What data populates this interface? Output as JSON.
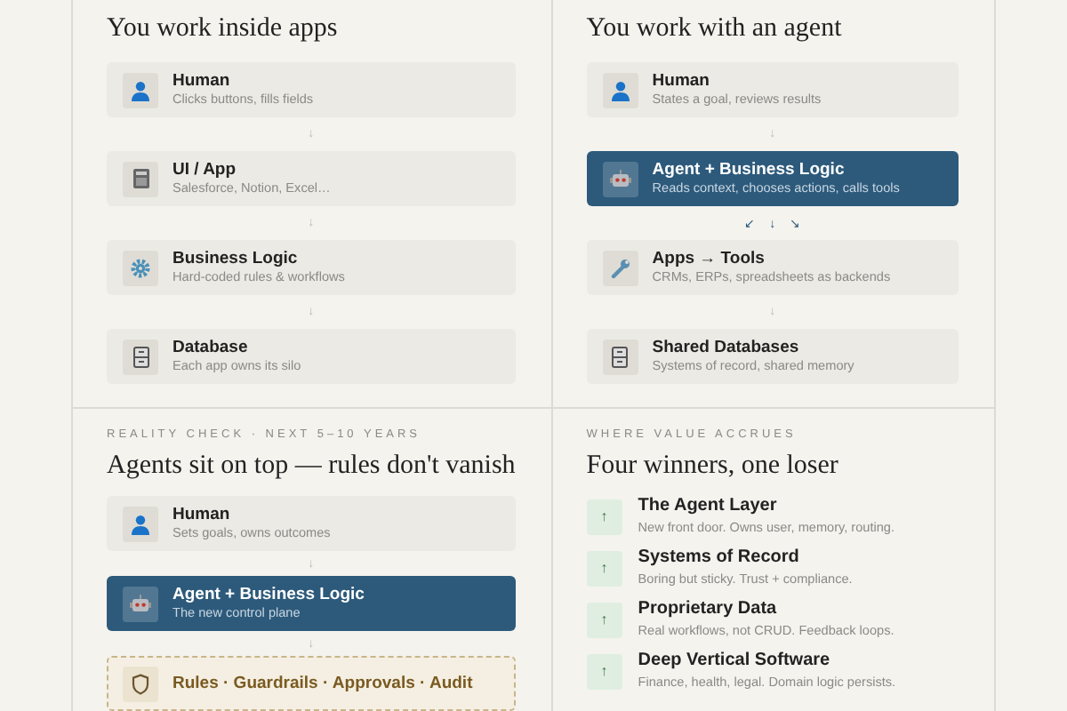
{
  "panels": [
    {
      "kind": "stack",
      "title": "You work inside apps",
      "items": [
        {
          "kind": "plain",
          "title": "Human",
          "subtitle": "Clicks buttons, fills fields"
        },
        {
          "kind": "connector",
          "text": "↓"
        },
        {
          "kind": "plain",
          "title": "UI / App",
          "subtitle": "Salesforce, Notion, Excel…"
        },
        {
          "kind": "connector",
          "text": "↓"
        },
        {
          "kind": "plain",
          "title": "Business Logic",
          "subtitle": "Hard-coded rules & workflows"
        },
        {
          "kind": "connector",
          "text": "↓"
        },
        {
          "kind": "plain",
          "title": "Database",
          "subtitle": "Each app owns its silo"
        }
      ]
    },
    {
      "kind": "stack",
      "title": "You work with an agent",
      "items": [
        {
          "kind": "plain",
          "title": "Human",
          "subtitle": "States a goal, reviews results"
        },
        {
          "kind": "connector",
          "text": "↓"
        },
        {
          "kind": "highlighted",
          "title": "Agent + Business Logic",
          "subtitle": "Reads context, chooses actions, calls tools"
        },
        {
          "kind": "fanout",
          "text": "↙ ↓ ↘"
        },
        {
          "kind": "plain",
          "title": "Apps → Tools",
          "subtitle": "CRMs, ERPs, spreadsheets as backends"
        },
        {
          "kind": "connector",
          "text": "↓"
        },
        {
          "kind": "plain",
          "title": "Shared Databases",
          "subtitle": "Systems of record, shared memory"
        }
      ]
    },
    {
      "kind": "stack",
      "eyebrow": "REALITY CHECK · NEXT 5–10 YEARS",
      "title": "Agents sit on top — rules don't vanish",
      "items": [
        {
          "kind": "plain",
          "title": "Human",
          "subtitle": "Sets goals, owns outcomes"
        },
        {
          "kind": "connector",
          "text": "↓"
        },
        {
          "kind": "highlighted",
          "title": "Agent + Business Logic",
          "subtitle": "The new control plane"
        },
        {
          "kind": "connector",
          "text": "↓"
        },
        {
          "kind": "dashed",
          "title": "Rules · Guardrails · Approvals · Audit"
        }
      ]
    },
    {
      "kind": "list",
      "eyebrow": "WHERE VALUE ACCRUES",
      "title": "Four winners, one loser",
      "items": [
        {
          "mark": "↑",
          "title": "The Agent Layer",
          "subtitle": "New front door. Owns user, memory, routing."
        },
        {
          "mark": "↑",
          "title": "Systems of Record",
          "subtitle": "Boring but sticky. Trust + compliance."
        },
        {
          "mark": "↑",
          "title": "Proprietary Data",
          "subtitle": "Real workflows, not CRUD. Feedback loops."
        },
        {
          "mark": "↑",
          "title": "Deep Vertical Software",
          "subtitle": "Finance, health, legal. Domain logic persists."
        }
      ]
    }
  ]
}
